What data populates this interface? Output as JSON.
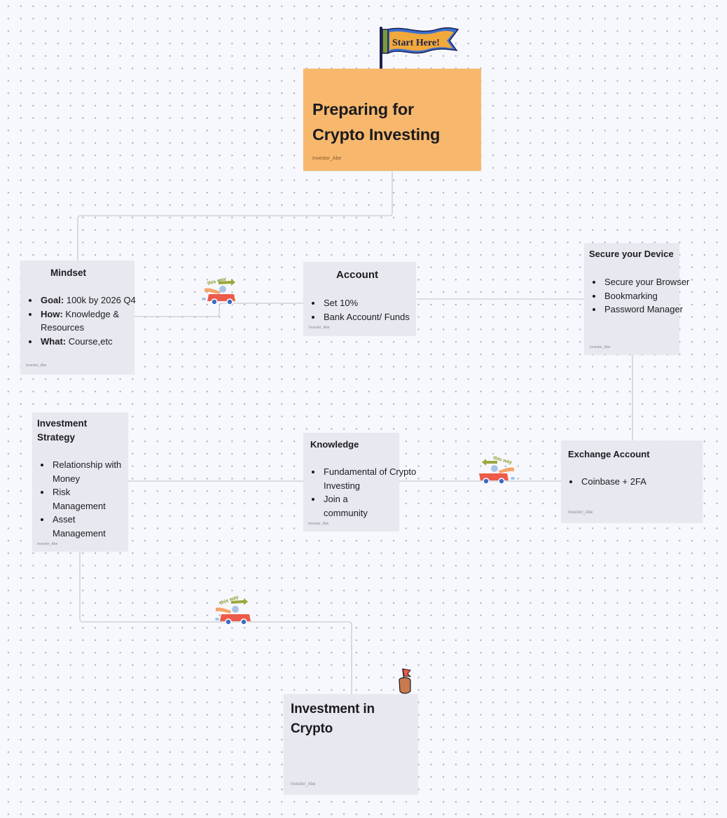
{
  "canvas": {
    "background": "#f7f8fd",
    "dot_color": "#a9abb6",
    "connector_color": "#c9cad1"
  },
  "start_flag": {
    "text": "Start Here!",
    "icon": "start-flag-banner"
  },
  "title_note": {
    "title_line1": "Preparing for",
    "title_line2": "Crypto Investing",
    "author": "Investor_Abe",
    "color": "#f7b86d"
  },
  "notes": {
    "mindset": {
      "title": "Mindset",
      "items": [
        {
          "label": "Goal:",
          "text": " 100k by 2026 Q4"
        },
        {
          "label": "How:",
          "text": " Knowledge & Resources"
        },
        {
          "label": "What:",
          "text": " Course,etc"
        }
      ],
      "author": "Investor_Abe"
    },
    "account": {
      "title": "Account",
      "items": [
        "Set 10%",
        "Bank Account/ Funds"
      ],
      "author": "Investor_Abe"
    },
    "secure_device": {
      "title": "Secure your Device",
      "items": [
        "Secure your Browser",
        "Bookmarking",
        "Password Manager"
      ],
      "author": "Investor_Abe"
    },
    "investment_strategy": {
      "title": "Investment Strategy",
      "items": [
        "Relationship with Money",
        "Risk Management",
        "Asset Management"
      ],
      "author": "Investor_Abe"
    },
    "knowledge": {
      "title": "Knowledge",
      "items": [
        "Fundamental of Crypto Investing",
        "Join a community"
      ],
      "author": "Investor_Abe"
    },
    "exchange_account": {
      "title": "Exchange Account",
      "items": [
        "Coinbase + 2FA"
      ],
      "author": "Investor_Abe"
    },
    "investment_crypto": {
      "title_line1": "Investment in",
      "title_line2": "Crypto",
      "author": "Investor_Abe"
    }
  },
  "stickers": {
    "car_1": {
      "text": "this way",
      "direction": "right"
    },
    "car_2": {
      "text": "this way",
      "direction": "left"
    },
    "car_3": {
      "text": "this way",
      "direction": "right"
    },
    "hand_flag": {
      "icon": "hand-holding-flag"
    }
  },
  "note_color": "#e8e8f0"
}
